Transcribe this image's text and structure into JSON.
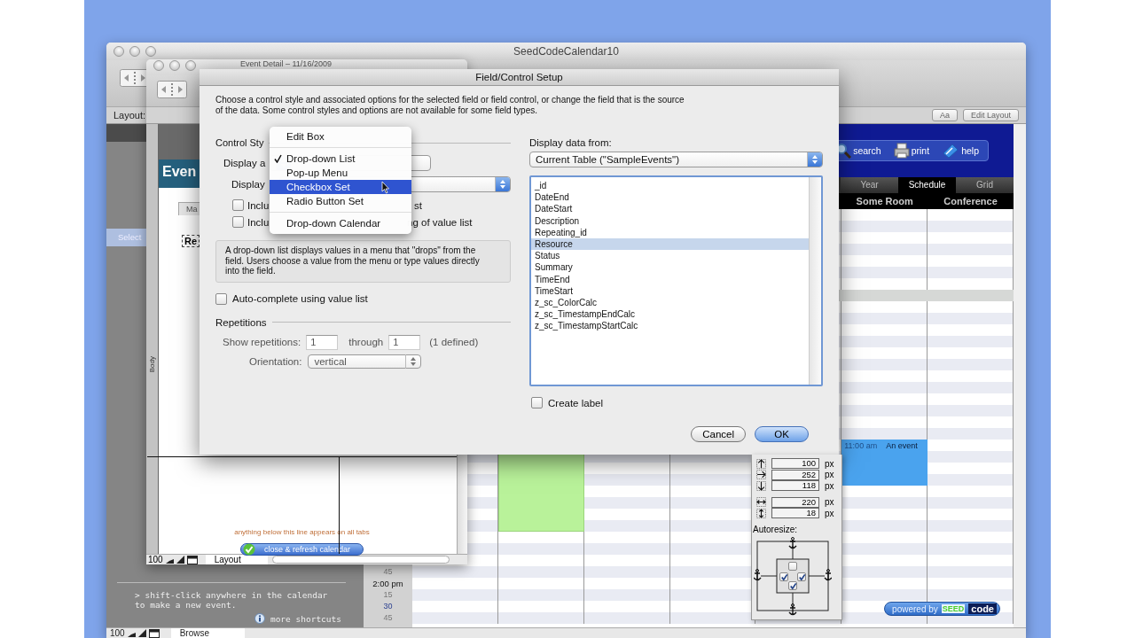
{
  "main_window": {
    "title": "SeedCodeCalendar10",
    "layout_label": "Layout:",
    "font_button": "Aa",
    "edit_layout_button": "Edit Layout",
    "toolbar_buttons": [
      {
        "kind": "search",
        "label": "search"
      },
      {
        "kind": "print",
        "label": "print"
      },
      {
        "kind": "help",
        "label": "help"
      }
    ],
    "view_tabs": [
      {
        "label": "Year",
        "selected": false
      },
      {
        "label": "Schedule",
        "selected": true
      },
      {
        "label": "Grid",
        "selected": false
      }
    ],
    "columns": [
      "Some Room",
      "Conference"
    ],
    "event": {
      "time": "11:00 am",
      "title": "An event"
    },
    "sidebar": {
      "select_label": "Select",
      "hint": "> shift-click anywhere in the calendar to make a new event.",
      "shortcuts_link": "more shortcuts"
    },
    "times": [
      {
        "label": "45",
        "kind": "quarter"
      },
      {
        "label": "2:00 pm",
        "kind": "hour"
      },
      {
        "label": "15",
        "kind": "quarter"
      },
      {
        "label": "30",
        "kind": "half"
      },
      {
        "label": "45",
        "kind": "quarter"
      }
    ],
    "powered_by": {
      "prefix": "powered by",
      "brand_left": "SEED",
      "brand_right": "code"
    },
    "status_bar": {
      "zoom": "100",
      "mode": "Browse"
    }
  },
  "event_window": {
    "title": "Event Detail – 11/16/2009",
    "heading": "Even",
    "tab": "Ma",
    "field": "Re",
    "part_label": "Body",
    "footer_note": "anything below this line appears on all tabs",
    "close_button": "close & refresh calendar",
    "status_bar": {
      "zoom": "100",
      "mode": "Layout"
    }
  },
  "dialog": {
    "title": "Field/Control Setup",
    "intro": "Choose a control style and associated options for the selected field or field control, or change the field that is the source of the data. Some control styles and options are not available for some field types.",
    "control_style_label": "Control Sty",
    "display_as_label": "Display a",
    "display_label": "Display",
    "options": [
      {
        "text_start": "Inclu",
        "text_end": "st",
        "checked": false
      },
      {
        "text_start": "Inclu",
        "text_end": "ng of value list",
        "checked": false
      }
    ],
    "help_text": "A drop-down list displays values in a menu that \"drops\" from the field. Users choose a value from the menu or type values directly into the field.",
    "autocomplete": {
      "label": "Auto-complete using value list",
      "checked": false
    },
    "repetitions": {
      "heading": "Repetitions",
      "show_label": "Show repetitions:",
      "from": "1",
      "through_label": "through",
      "to": "1",
      "defined": "(1 defined)",
      "orientation_label": "Orientation:",
      "orientation": "vertical"
    },
    "source_label": "Display data from:",
    "source": "Current Table (\"SampleEvents\")",
    "fields": [
      {
        "name": "_id",
        "selected": false
      },
      {
        "name": "DateEnd",
        "selected": false
      },
      {
        "name": "DateStart",
        "selected": false
      },
      {
        "name": "Description",
        "selected": false
      },
      {
        "name": "Repeating_id",
        "selected": false
      },
      {
        "name": "Resource",
        "selected": true
      },
      {
        "name": "Status",
        "selected": false
      },
      {
        "name": "Summary",
        "selected": false
      },
      {
        "name": "TimeEnd",
        "selected": false
      },
      {
        "name": "TimeStart",
        "selected": false
      },
      {
        "name": "z_sc_ColorCalc",
        "selected": false
      },
      {
        "name": "z_sc_TimestampEndCalc",
        "selected": false
      },
      {
        "name": "z_sc_TimestampStartCalc",
        "selected": false
      }
    ],
    "create_label": {
      "label": "Create label",
      "checked": false
    },
    "buttons": [
      {
        "label": "Cancel",
        "default": false
      },
      {
        "label": "OK",
        "default": true
      }
    ],
    "menu": {
      "items": [
        {
          "kind": "item",
          "label": "Edit Box",
          "checked": false,
          "selected": false
        },
        {
          "kind": "separator"
        },
        {
          "kind": "item",
          "label": "Drop-down List",
          "checked": true,
          "selected": false
        },
        {
          "kind": "item",
          "label": "Pop-up Menu",
          "checked": false,
          "selected": false
        },
        {
          "kind": "item",
          "label": "Checkbox Set",
          "checked": false,
          "selected": true
        },
        {
          "kind": "item",
          "label": "Radio Button Set",
          "checked": false,
          "selected": false
        },
        {
          "kind": "separator"
        },
        {
          "kind": "item",
          "label": "Drop-down Calendar",
          "checked": false,
          "selected": false
        }
      ]
    }
  },
  "inspector": {
    "position": [
      {
        "kind": "top",
        "value": "100",
        "unit": "px"
      },
      {
        "kind": "left",
        "value": "252",
        "unit": "px"
      },
      {
        "kind": "bottom",
        "value": "118",
        "unit": "px"
      }
    ],
    "size": [
      {
        "kind": "width",
        "value": "220",
        "unit": "px"
      },
      {
        "kind": "height",
        "value": "18",
        "unit": "px"
      }
    ],
    "autoresize_label": "Autoresize:",
    "anchors": {
      "top": false,
      "left": true,
      "right": true,
      "bottom": true
    }
  }
}
